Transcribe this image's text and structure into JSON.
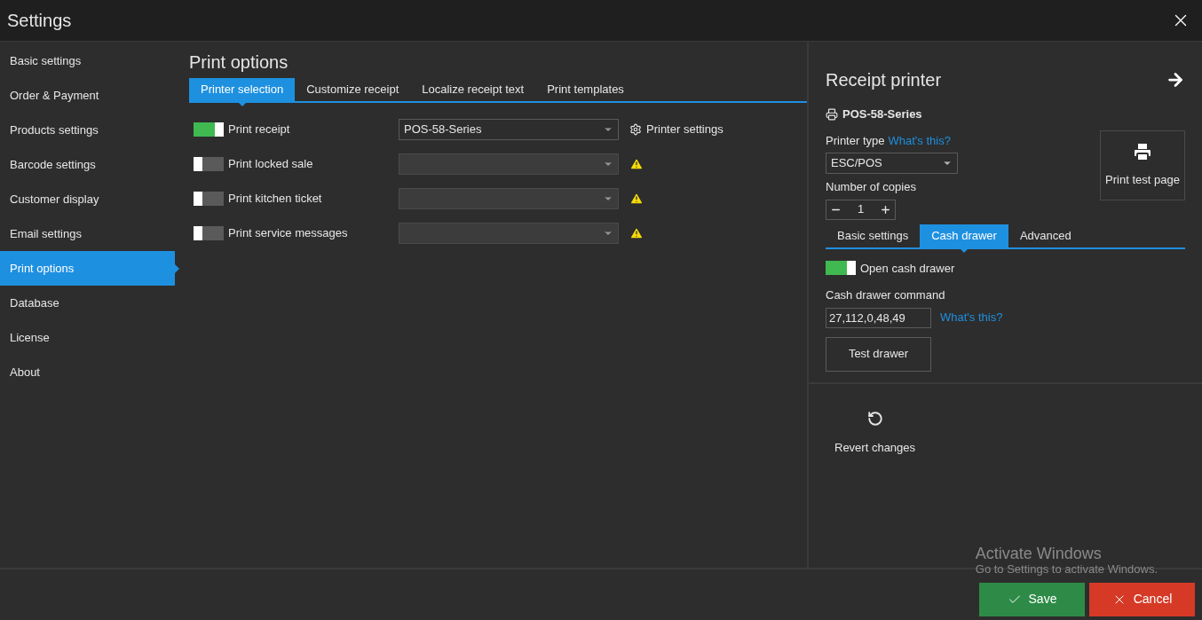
{
  "window": {
    "title": "Settings"
  },
  "sidebar": {
    "items": [
      {
        "label": "Basic settings",
        "selected": false
      },
      {
        "label": "Order & Payment",
        "selected": false
      },
      {
        "label": "Products settings",
        "selected": false
      },
      {
        "label": "Barcode settings",
        "selected": false
      },
      {
        "label": "Customer display",
        "selected": false
      },
      {
        "label": "Email settings",
        "selected": false
      },
      {
        "label": "Print options",
        "selected": true
      },
      {
        "label": "Database",
        "selected": false
      },
      {
        "label": "License",
        "selected": false
      },
      {
        "label": "About",
        "selected": false
      }
    ]
  },
  "print_options": {
    "title": "Print options",
    "tabs": [
      {
        "label": "Printer selection",
        "selected": true
      },
      {
        "label": "Customize receipt",
        "selected": false
      },
      {
        "label": "Localize receipt text",
        "selected": false
      },
      {
        "label": "Print templates",
        "selected": false
      }
    ],
    "rows": [
      {
        "label": "Print receipt",
        "on": true,
        "printer": "POS-58-Series",
        "kind": "settings",
        "link": "Printer settings"
      },
      {
        "label": "Print locked sale",
        "on": false,
        "kind": "warning"
      },
      {
        "label": "Print kitchen ticket",
        "on": false,
        "kind": "warning"
      },
      {
        "label": "Print service messages",
        "on": false,
        "kind": "warning"
      }
    ]
  },
  "receipt_printer": {
    "title": "Receipt printer",
    "printer_name": "POS-58-Series",
    "printer_type_label": "Printer type",
    "printer_type_link": "What's this?",
    "printer_type_value": "ESC/POS",
    "copies_label": "Number of copies",
    "copies_value": "1",
    "test_page_button": "Print test page",
    "tabs": [
      {
        "label": "Basic settings",
        "selected": false
      },
      {
        "label": "Cash drawer",
        "selected": true
      },
      {
        "label": "Advanced",
        "selected": false
      }
    ],
    "open_cash_drawer": {
      "label": "Open cash drawer",
      "on": true
    },
    "command_label": "Cash drawer command",
    "command_value": "27,112,0,48,49",
    "command_link": "What's this?",
    "test_drawer_button": "Test drawer"
  },
  "revert_button": "Revert changes",
  "footer": {
    "save": "Save",
    "cancel": "Cancel"
  },
  "os_notice": {
    "title": "Activate Windows",
    "text": "Go to Settings to activate Windows."
  }
}
